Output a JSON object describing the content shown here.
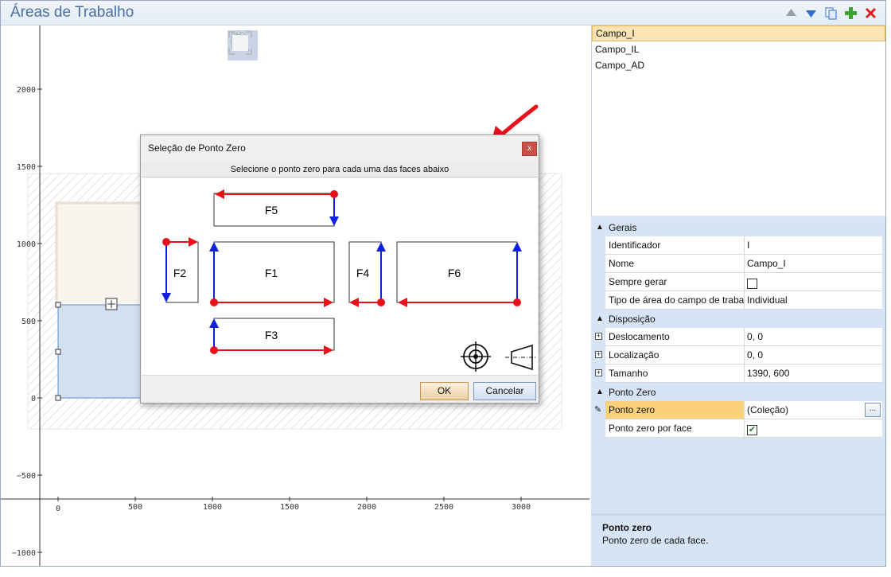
{
  "window": {
    "title": "Áreas de Trabalho",
    "toolbar_icons": [
      "move-up-icon",
      "move-down-icon",
      "copy-icon",
      "add-icon",
      "delete-icon"
    ]
  },
  "canvas": {
    "tools": [
      "pointer-icon",
      "pan-hand-icon",
      "zoom-icon",
      "fit-icon"
    ],
    "y_ticks": [
      "2000",
      "1500",
      "1000",
      "500",
      "0",
      "−500",
      "−1000"
    ],
    "x_ticks": [
      "0",
      "500",
      "1000",
      "1500",
      "2000",
      "2500",
      "3000"
    ]
  },
  "work_areas": {
    "items": [
      "Campo_I",
      "Campo_IL",
      "Campo_AD"
    ],
    "selected": "Campo_I"
  },
  "properties": {
    "categories": {
      "general": "Gerais",
      "layout": "Disposição",
      "zero_point": "Ponto Zero"
    },
    "rows": {
      "identifier": {
        "name": "Identificador",
        "value": "I"
      },
      "name": {
        "name": "Nome",
        "value": "Campo_I"
      },
      "always_generate": {
        "name": "Sempre gerar",
        "checked": false
      },
      "area_type": {
        "name": "Tipo de área do campo de trabalho",
        "value": "Individual"
      },
      "offset": {
        "name": "Deslocamento",
        "value": "0, 0"
      },
      "location": {
        "name": "Localização",
        "value": "0, 0"
      },
      "size": {
        "name": "Tamanho",
        "value": "1390, 600"
      },
      "zero_point": {
        "name": "Ponto zero",
        "value": "(Coleção)",
        "button": "..."
      },
      "zero_point_per_face": {
        "name": "Ponto zero por face",
        "checked": true
      }
    },
    "description": {
      "title": "Ponto zero",
      "text": "Ponto zero de cada face."
    }
  },
  "dialog": {
    "title": "Seleção de Ponto Zero",
    "close": "x",
    "instruction": "Selecione o ponto zero para cada uma das faces abaixo",
    "faces": [
      "F5",
      "F2",
      "F1",
      "F4",
      "F6",
      "F3"
    ],
    "ok": "OK",
    "cancel": "Cancelar",
    "colors": {
      "x_axis": "#e8101a",
      "y_axis": "#1020e0",
      "origin": "#e8101a"
    }
  }
}
